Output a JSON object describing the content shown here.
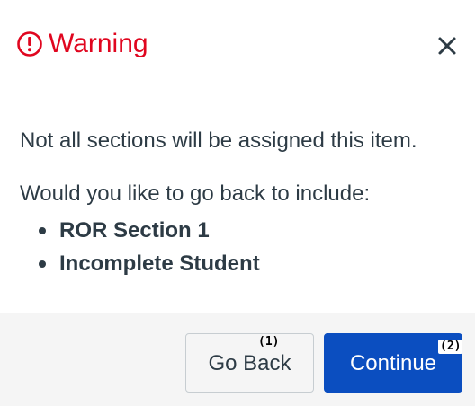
{
  "dialog": {
    "title": "Warning",
    "icon": "warning-circle-icon",
    "close_icon": "close-icon",
    "title_color": "#e0061f"
  },
  "body": {
    "message_1": "Not all sections will be assigned this item.",
    "message_2": "Would you like to go back to include:",
    "items": [
      "ROR Section 1",
      "Incomplete Student"
    ]
  },
  "footer": {
    "back_label": "Go Back",
    "continue_label": "Continue",
    "primary_color": "#0b4ec0"
  },
  "markers": [
    "(1)",
    "(2)"
  ]
}
